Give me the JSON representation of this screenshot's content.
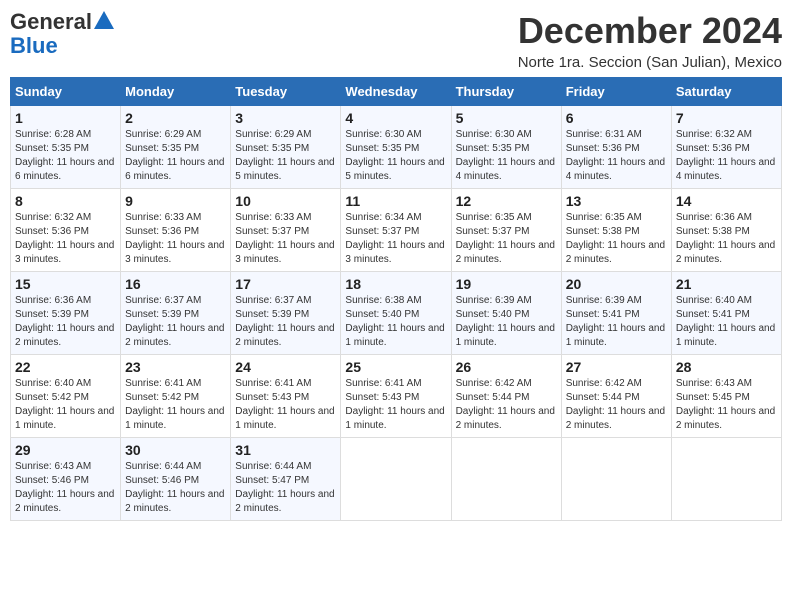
{
  "logo": {
    "general": "General",
    "blue": "Blue"
  },
  "title": "December 2024",
  "location": "Norte 1ra. Seccion (San Julian), Mexico",
  "days_of_week": [
    "Sunday",
    "Monday",
    "Tuesday",
    "Wednesday",
    "Thursday",
    "Friday",
    "Saturday"
  ],
  "weeks": [
    [
      {
        "day": "1",
        "sunrise": "6:28 AM",
        "sunset": "5:35 PM",
        "daylight": "11 hours and 6 minutes."
      },
      {
        "day": "2",
        "sunrise": "6:29 AM",
        "sunset": "5:35 PM",
        "daylight": "11 hours and 6 minutes."
      },
      {
        "day": "3",
        "sunrise": "6:29 AM",
        "sunset": "5:35 PM",
        "daylight": "11 hours and 5 minutes."
      },
      {
        "day": "4",
        "sunrise": "6:30 AM",
        "sunset": "5:35 PM",
        "daylight": "11 hours and 5 minutes."
      },
      {
        "day": "5",
        "sunrise": "6:30 AM",
        "sunset": "5:35 PM",
        "daylight": "11 hours and 4 minutes."
      },
      {
        "day": "6",
        "sunrise": "6:31 AM",
        "sunset": "5:36 PM",
        "daylight": "11 hours and 4 minutes."
      },
      {
        "day": "7",
        "sunrise": "6:32 AM",
        "sunset": "5:36 PM",
        "daylight": "11 hours and 4 minutes."
      }
    ],
    [
      {
        "day": "8",
        "sunrise": "6:32 AM",
        "sunset": "5:36 PM",
        "daylight": "11 hours and 3 minutes."
      },
      {
        "day": "9",
        "sunrise": "6:33 AM",
        "sunset": "5:36 PM",
        "daylight": "11 hours and 3 minutes."
      },
      {
        "day": "10",
        "sunrise": "6:33 AM",
        "sunset": "5:37 PM",
        "daylight": "11 hours and 3 minutes."
      },
      {
        "day": "11",
        "sunrise": "6:34 AM",
        "sunset": "5:37 PM",
        "daylight": "11 hours and 3 minutes."
      },
      {
        "day": "12",
        "sunrise": "6:35 AM",
        "sunset": "5:37 PM",
        "daylight": "11 hours and 2 minutes."
      },
      {
        "day": "13",
        "sunrise": "6:35 AM",
        "sunset": "5:38 PM",
        "daylight": "11 hours and 2 minutes."
      },
      {
        "day": "14",
        "sunrise": "6:36 AM",
        "sunset": "5:38 PM",
        "daylight": "11 hours and 2 minutes."
      }
    ],
    [
      {
        "day": "15",
        "sunrise": "6:36 AM",
        "sunset": "5:39 PM",
        "daylight": "11 hours and 2 minutes."
      },
      {
        "day": "16",
        "sunrise": "6:37 AM",
        "sunset": "5:39 PM",
        "daylight": "11 hours and 2 minutes."
      },
      {
        "day": "17",
        "sunrise": "6:37 AM",
        "sunset": "5:39 PM",
        "daylight": "11 hours and 2 minutes."
      },
      {
        "day": "18",
        "sunrise": "6:38 AM",
        "sunset": "5:40 PM",
        "daylight": "11 hours and 1 minute."
      },
      {
        "day": "19",
        "sunrise": "6:39 AM",
        "sunset": "5:40 PM",
        "daylight": "11 hours and 1 minute."
      },
      {
        "day": "20",
        "sunrise": "6:39 AM",
        "sunset": "5:41 PM",
        "daylight": "11 hours and 1 minute."
      },
      {
        "day": "21",
        "sunrise": "6:40 AM",
        "sunset": "5:41 PM",
        "daylight": "11 hours and 1 minute."
      }
    ],
    [
      {
        "day": "22",
        "sunrise": "6:40 AM",
        "sunset": "5:42 PM",
        "daylight": "11 hours and 1 minute."
      },
      {
        "day": "23",
        "sunrise": "6:41 AM",
        "sunset": "5:42 PM",
        "daylight": "11 hours and 1 minute."
      },
      {
        "day": "24",
        "sunrise": "6:41 AM",
        "sunset": "5:43 PM",
        "daylight": "11 hours and 1 minute."
      },
      {
        "day": "25",
        "sunrise": "6:41 AM",
        "sunset": "5:43 PM",
        "daylight": "11 hours and 1 minute."
      },
      {
        "day": "26",
        "sunrise": "6:42 AM",
        "sunset": "5:44 PM",
        "daylight": "11 hours and 2 minutes."
      },
      {
        "day": "27",
        "sunrise": "6:42 AM",
        "sunset": "5:44 PM",
        "daylight": "11 hours and 2 minutes."
      },
      {
        "day": "28",
        "sunrise": "6:43 AM",
        "sunset": "5:45 PM",
        "daylight": "11 hours and 2 minutes."
      }
    ],
    [
      {
        "day": "29",
        "sunrise": "6:43 AM",
        "sunset": "5:46 PM",
        "daylight": "11 hours and 2 minutes."
      },
      {
        "day": "30",
        "sunrise": "6:44 AM",
        "sunset": "5:46 PM",
        "daylight": "11 hours and 2 minutes."
      },
      {
        "day": "31",
        "sunrise": "6:44 AM",
        "sunset": "5:47 PM",
        "daylight": "11 hours and 2 minutes."
      },
      null,
      null,
      null,
      null
    ]
  ]
}
